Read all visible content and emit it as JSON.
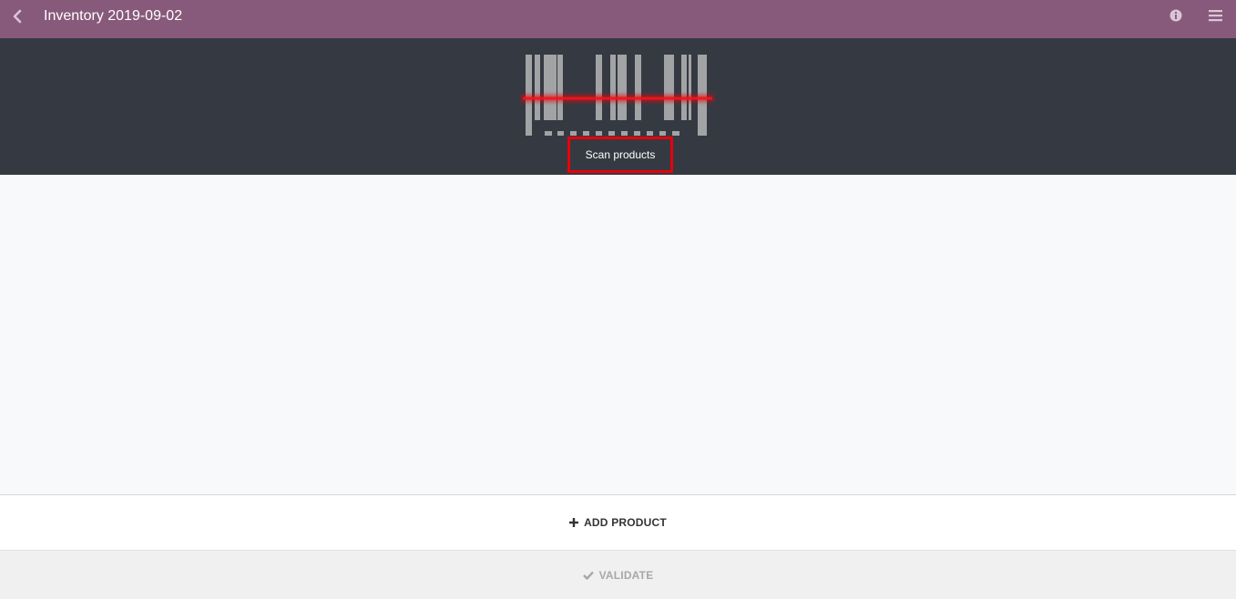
{
  "header": {
    "title": "Inventory 2019-09-02",
    "back_icon": "chevron-left-icon",
    "info_icon": "info-circle-icon",
    "menu_icon": "hamburger-menu-icon",
    "bar_color": "#875a7b"
  },
  "scanner": {
    "instruction": "Scan products",
    "barcode_icon": "barcode-icon",
    "laser_color": "#e8000b",
    "panel_color": "#353a42"
  },
  "actions": {
    "add_product_label": "ADD PRODUCT",
    "add_icon": "plus-icon",
    "validate_label": "VALIDATE",
    "validate_icon": "check-icon"
  }
}
